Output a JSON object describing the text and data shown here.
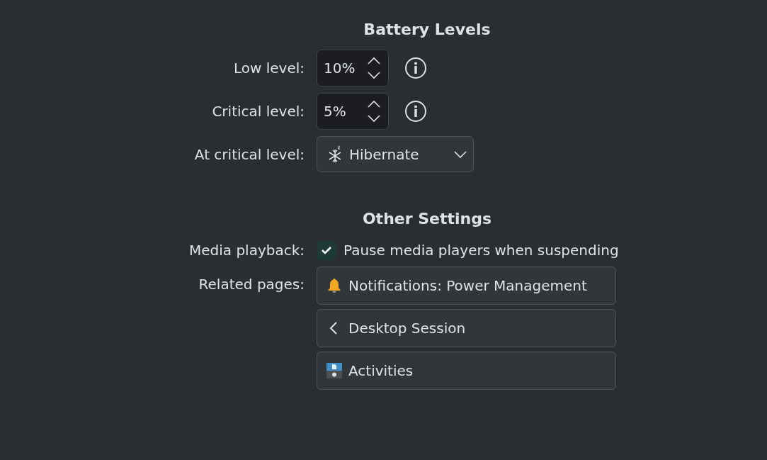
{
  "sections": [
    {
      "title": "Battery Levels",
      "rows": [
        {
          "kind": "spin",
          "label": "Low level:",
          "value": "10%"
        },
        {
          "kind": "spin",
          "label": "Critical level:",
          "value": "5%"
        },
        {
          "kind": "dropdown",
          "label": "At critical level:",
          "value": "Hibernate"
        }
      ]
    },
    {
      "title": "Other Settings",
      "rows": [
        {
          "kind": "checkbox",
          "label": "Media playback:",
          "text": "Pause media players when suspending",
          "checked": true
        },
        {
          "kind": "links",
          "label": "Related pages:",
          "links": [
            {
              "kind": "bell",
              "text": "Notifications: Power Management"
            },
            {
              "kind": "back",
              "text": "Desktop Session"
            },
            {
              "kind": "activities",
              "text": "Activities"
            }
          ]
        }
      ]
    }
  ]
}
